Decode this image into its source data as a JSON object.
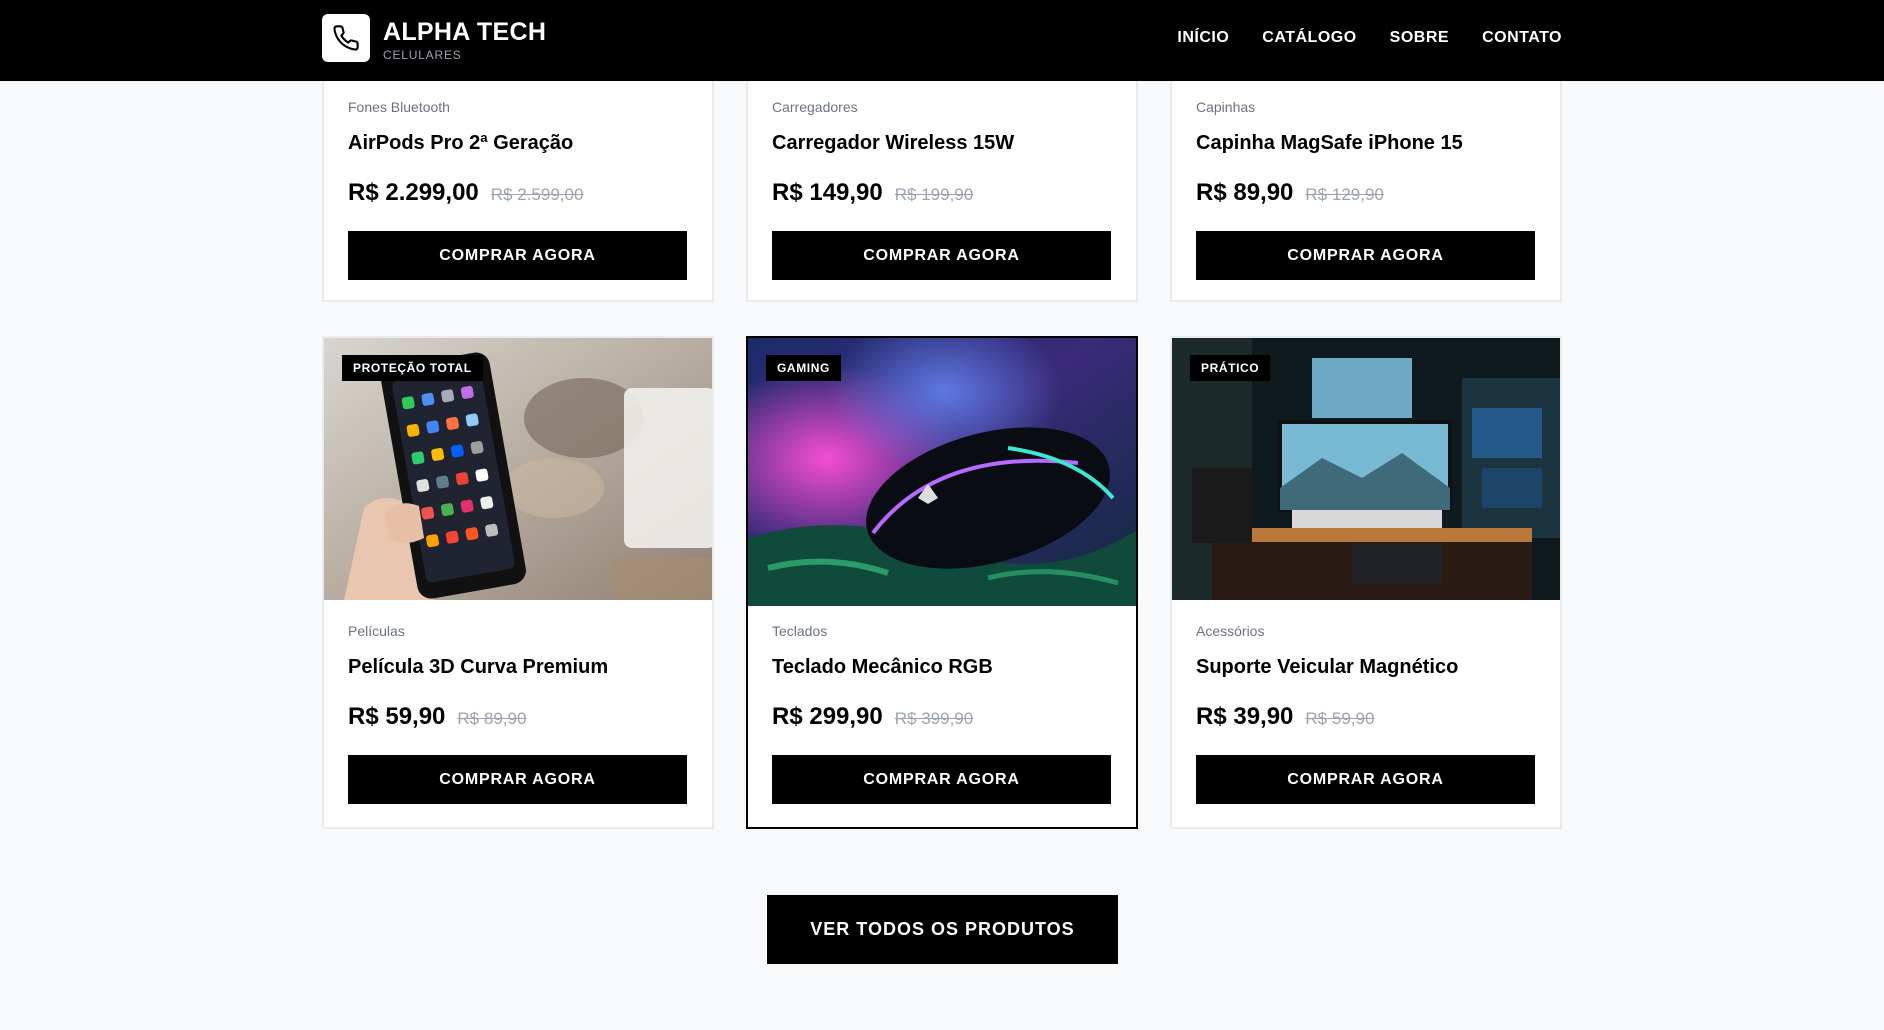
{
  "header": {
    "brand_name": "ALPHA TECH",
    "brand_sub": "CELULARES",
    "logo_icon": "phone-icon",
    "nav": [
      "INÍCIO",
      "CATÁLOGO",
      "SOBRE",
      "CONTATO"
    ]
  },
  "top_products": [
    {
      "category": "Fones Bluetooth",
      "name": "AirPods Pro 2ª Geração",
      "price": "R$ 2.299,00",
      "old_price": "R$ 2.599,00",
      "button": "COMPRAR AGORA"
    },
    {
      "category": "Carregadores",
      "name": "Carregador Wireless 15W",
      "price": "R$ 149,90",
      "old_price": "R$ 199,90",
      "button": "COMPRAR AGORA"
    },
    {
      "category": "Capinhas",
      "name": "Capinha MagSafe iPhone 15",
      "price": "R$ 89,90",
      "old_price": "R$ 129,90",
      "button": "COMPRAR AGORA"
    }
  ],
  "products": [
    {
      "badge": "PROTEÇÃO TOTAL",
      "category": "Películas",
      "name": "Película 3D Curva Premium",
      "price": "R$ 59,90",
      "old_price": "R$ 89,90",
      "button": "COMPRAR AGORA"
    },
    {
      "badge": "GAMING",
      "category": "Teclados",
      "name": "Teclado Mecânico RGB",
      "price": "R$ 299,90",
      "old_price": "R$ 399,90",
      "button": "COMPRAR AGORA"
    },
    {
      "badge": "PRÁTICO",
      "category": "Acessórios",
      "name": "Suporte Veicular Magnético",
      "price": "R$ 39,90",
      "old_price": "R$ 59,90",
      "button": "COMPRAR AGORA"
    }
  ],
  "view_all": "VER TODOS OS PRODUTOS",
  "colors": {
    "header_bg": "#000000",
    "page_bg": "#f8f9fb",
    "button_bg": "#000000",
    "muted": "#6b7280"
  }
}
